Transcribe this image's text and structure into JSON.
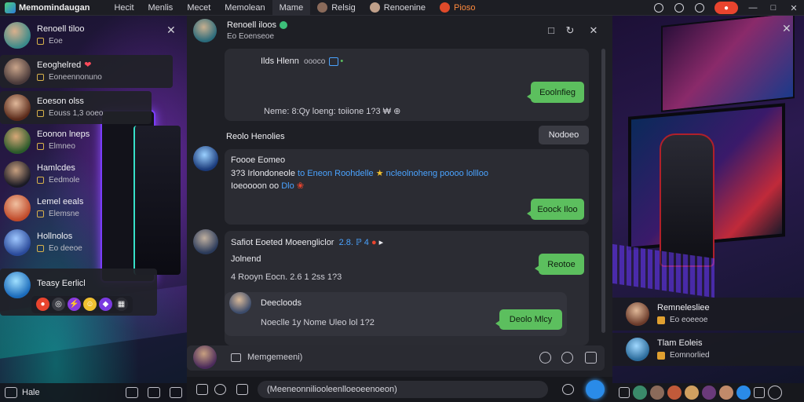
{
  "window": {
    "title": "Memomindaugan"
  },
  "tabs": [
    {
      "label": "Hecit"
    },
    {
      "label": "Menlis"
    },
    {
      "label": "Mecet"
    },
    {
      "label": "Memolean",
      "active": true
    },
    {
      "label": "Mame"
    },
    {
      "label": "Relsig"
    },
    {
      "label": "Renoenine"
    },
    {
      "label": "Pioso",
      "highlight": true
    }
  ],
  "colors": {
    "accent_green": "#5cbf5e",
    "accent_blue": "#2a8be8",
    "notify_red": "#e8442e",
    "card_bg": "#2b2c33"
  },
  "sidebar": {
    "contacts": [
      {
        "name": "Renoell tiloo",
        "sub": "Eoe"
      },
      {
        "name": "Eeoghelred",
        "sub": "Eoneennonuno",
        "heart": true
      },
      {
        "name": "Eoeson olss",
        "sub": "Eouss 1,3 ooeo"
      },
      {
        "name": "Eoonon lneps",
        "sub": "Elmneo"
      },
      {
        "name": "Hamlcdes",
        "sub": "Eedmole"
      },
      {
        "name": "Lemel eeals",
        "sub": "Elemsne"
      },
      {
        "name": "Hollnolos",
        "sub": "Eo deeoe"
      },
      {
        "name": "Teasy Eerlicl",
        "sub": ""
      }
    ],
    "bottom_label": "Hale"
  },
  "chat": {
    "header": {
      "name": "Renoell iloos",
      "status": "Eo Eoenseoe"
    },
    "messages": [
      {
        "name": "Ilds Hlenn",
        "meta": "oooco",
        "body": "Neme: 8:Qy loeng: toiione 1?3 ₩ ⊕",
        "button": "Eoolnfieg"
      },
      {
        "section_title": "Reolo Henolies",
        "button": "Nodoeo"
      },
      {
        "name": "Foooe Eomeo",
        "body_line1": "3?3 Irlondoneole",
        "body_link": "to Eneon Roohdelle",
        "body_line1_tail": "ncleolnoheng poooo lollloo",
        "body_line2": "Ioeoooon oo ",
        "body_line2_blue": "Dlo",
        "button": "Eoock Iloo"
      },
      {
        "name": "Safiot Eoeted Moeengliclor",
        "name_tail": "2.8. ℙ 4",
        "body1": "Jolnend",
        "body2": "4 Rooyn Eocn. 2.6 1 2ss 1?3",
        "button": "Reotoe"
      },
      {
        "name": "Deecloods",
        "body": "Noeclle 1y Nome Uleo lol 1?2",
        "button": "Deolo Mlcy"
      }
    ],
    "composer_placeholder": "Memgemeeni)",
    "bottom_input": "(Meeneonniliooleenlloeoeenoeon)"
  },
  "right_panel": {
    "cards": [
      {
        "name": "Remnelesliee",
        "sub": "Eo eoeeoe"
      },
      {
        "name": "Tlam Eoleis",
        "sub": "Eomnorlied"
      }
    ]
  }
}
